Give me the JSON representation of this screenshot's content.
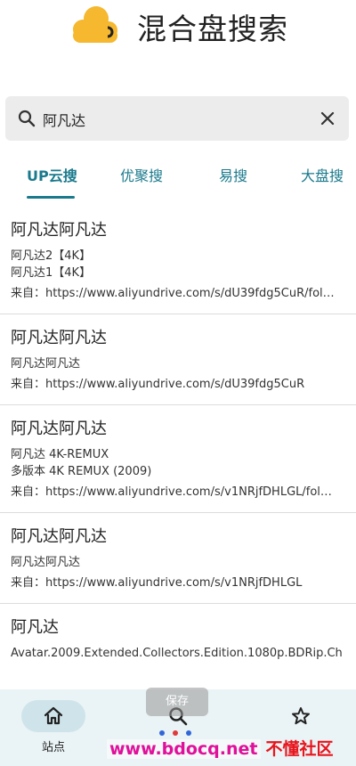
{
  "app": {
    "title": "混合盘搜索"
  },
  "search": {
    "value": "阿凡达",
    "placeholder": ""
  },
  "tabs": [
    {
      "label": "UP云搜",
      "active": true
    },
    {
      "label": "优聚搜",
      "active": false
    },
    {
      "label": "易搜",
      "active": false
    },
    {
      "label": "大盘搜",
      "active": false
    }
  ],
  "results": [
    {
      "title": "阿凡达阿凡达",
      "lines": [
        "阿凡达2【4K】",
        "阿凡达1【4K】"
      ],
      "source": "来自：https://www.aliyundrive.com/s/dU39fdg5CuR/fol…"
    },
    {
      "title": "阿凡达阿凡达",
      "lines": [
        "阿凡达阿凡达"
      ],
      "source": "来自：https://www.aliyundrive.com/s/dU39fdg5CuR"
    },
    {
      "title": "阿凡达阿凡达",
      "lines": [
        "阿凡达 4K-REMUX",
        "多版本 4K REMUX (2009)"
      ],
      "source": "来自：https://www.aliyundrive.com/s/v1NRjfDHLGL/fol…"
    },
    {
      "title": "阿凡达阿凡达",
      "lines": [
        "阿凡达阿凡达"
      ],
      "source": "来自：https://www.aliyundrive.com/s/v1NRjfDHLGL"
    },
    {
      "title": "阿凡达",
      "lines": [
        "Avatar.2009.Extended.Collectors.Edition.1080p.BDRip.Ch"
      ],
      "source": ""
    }
  ],
  "nav": [
    {
      "label": "站点",
      "icon": "home-icon",
      "active": true
    },
    {
      "label": "",
      "icon": "search-icon",
      "active": false
    },
    {
      "label": "",
      "icon": "star-icon",
      "active": false
    }
  ],
  "toast": {
    "text": "保存"
  },
  "watermark": {
    "url": "www.bdocq.net",
    "name": "不懂社区"
  },
  "colors": {
    "accent": "#1a7a8c",
    "logo": "#f5b82e",
    "nav_bg": "#eaf3f5",
    "nav_pill": "#cfe4ea",
    "search_bg": "#ececec",
    "watermark_pink": "#e0109a",
    "watermark_red": "#e8141c"
  }
}
